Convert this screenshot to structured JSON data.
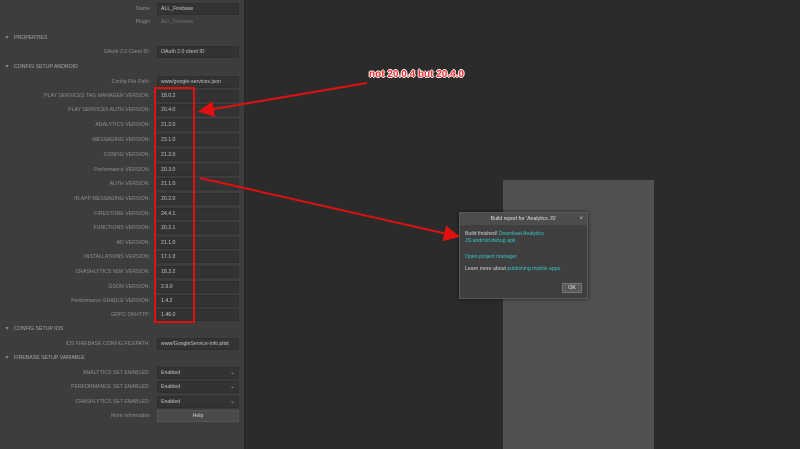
{
  "top": [
    {
      "label": "Name",
      "value": "ALL_Firebase",
      "dim": false
    },
    {
      "label": "Plugin",
      "value": "ALL_Firebase",
      "dim": true
    }
  ],
  "properties": {
    "title": "PROPERTIES",
    "fields": [
      {
        "label": "OAuth 2.0 Client ID:",
        "value": "OAuth 2.0 client ID"
      }
    ]
  },
  "android": {
    "title": "CONFIG SETUP ANDROID",
    "fields": [
      {
        "label": "Config File Path:",
        "value": "www/google-services.json"
      },
      {
        "label": "PLAY SERVICES TAG MANAGER VERSION:",
        "value": "18.0.2"
      },
      {
        "label": "PLAY SERVICES AUTH VERSION:",
        "value": "20.4.0"
      },
      {
        "label": "ANALYTICS VERSION:",
        "value": "21.2.0"
      },
      {
        "label": "MESSAGING VERSION:",
        "value": "23.1.0"
      },
      {
        "label": "CONFIG VERSION:",
        "value": "21.2.0"
      },
      {
        "label": "Performance VERSION:",
        "value": "20.3.0"
      },
      {
        "label": "AUTH VERSION:",
        "value": "21.1.0"
      },
      {
        "label": "IN APP MESSAGING VERSION:",
        "value": "20.2.0"
      },
      {
        "label": "FIRESTORE VERSION:",
        "value": "24.4.1"
      },
      {
        "label": "FUNCTIONS VERSION:",
        "value": "20.2.1"
      },
      {
        "label": "AD VERSION:",
        "value": "21.1.0"
      },
      {
        "label": "INSTALLATIONS VERSION:",
        "value": "17.1.0"
      },
      {
        "label": "CRASHLYTICS NDK VERSION:",
        "value": "18.3.2"
      },
      {
        "label": "GSON VERSION:",
        "value": "2.9.0"
      },
      {
        "label": "Performance GRADLE VERSION:",
        "value": "1.4.2"
      },
      {
        "label": "GRPC OKHTTP:",
        "value": "1.46.0"
      }
    ]
  },
  "ios": {
    "title": "CONFIG SETUP IOS",
    "fields": [
      {
        "label": "IOS FIREBASE CONFIG FILEPATH:",
        "value": "www/GoogleService-Info.plist"
      }
    ]
  },
  "variable": {
    "title": "FIREBASE SETUP VARIABLE",
    "fields": [
      {
        "label": "ANALYTICS SET ENABLED:",
        "value": "Enabled"
      },
      {
        "label": "PERFORMANCE SET ENABLED:",
        "value": "Enabled"
      },
      {
        "label": "CRASHLYTICS SET ENABLED:",
        "value": "Enabled"
      }
    ],
    "more_label": "More information",
    "help_label": "Help"
  },
  "dialog": {
    "title": "Build report for 'Analytics JS'",
    "close": "×",
    "finished_prefix": "Build finished!",
    "download_link": "Download Analytics JS.android.debug.apk",
    "open_manager": "Open project manager",
    "learn_prefix": "Learn more about",
    "learn_link": "publishing mobile apps",
    "ok": "OK"
  },
  "annotation": {
    "text": "not 20.0.4 but 20.4.0"
  }
}
